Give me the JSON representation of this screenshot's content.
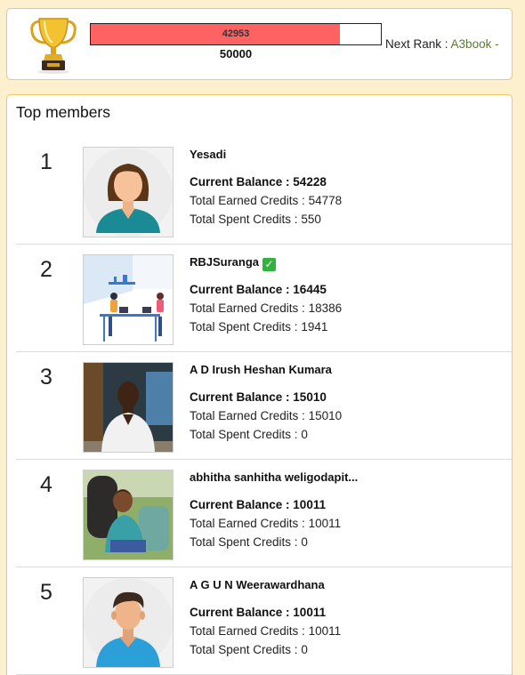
{
  "rank_card": {
    "current_credits": "42953",
    "target_credits": "50000",
    "progress_fraction": 0.859,
    "next_rank_label": "Next Rank :",
    "next_rank_name": "A3book -",
    "progress_color": "#ff6262",
    "icon": "trophy-icon"
  },
  "members": {
    "title": "Top members",
    "balance_label": "Current Balance :",
    "earned_label": "Total Earned Credits :",
    "spent_label": "Total Spent Credits :",
    "list": [
      {
        "rank": "1",
        "name": "Yesadi",
        "verified": false,
        "balance": "54228",
        "earned": "54778",
        "spent": "550",
        "avatar": "female-avatar"
      },
      {
        "rank": "2",
        "name": "RBJSuranga",
        "verified": true,
        "balance": "16445",
        "earned": "18386",
        "spent": "1941",
        "avatar": "office-illustration"
      },
      {
        "rank": "3",
        "name": "A D Irush Heshan Kumara",
        "verified": false,
        "balance": "15010",
        "earned": "15010",
        "spent": "0",
        "avatar": "photo"
      },
      {
        "rank": "4",
        "name": "abhitha sanhitha weligodapit...",
        "verified": false,
        "balance": "10011",
        "earned": "10011",
        "spent": "0",
        "avatar": "photo"
      },
      {
        "rank": "5",
        "name": "A G U N Weerawardhana",
        "verified": false,
        "balance": "10011",
        "earned": "10011",
        "spent": "0",
        "avatar": "male-avatar"
      }
    ]
  }
}
